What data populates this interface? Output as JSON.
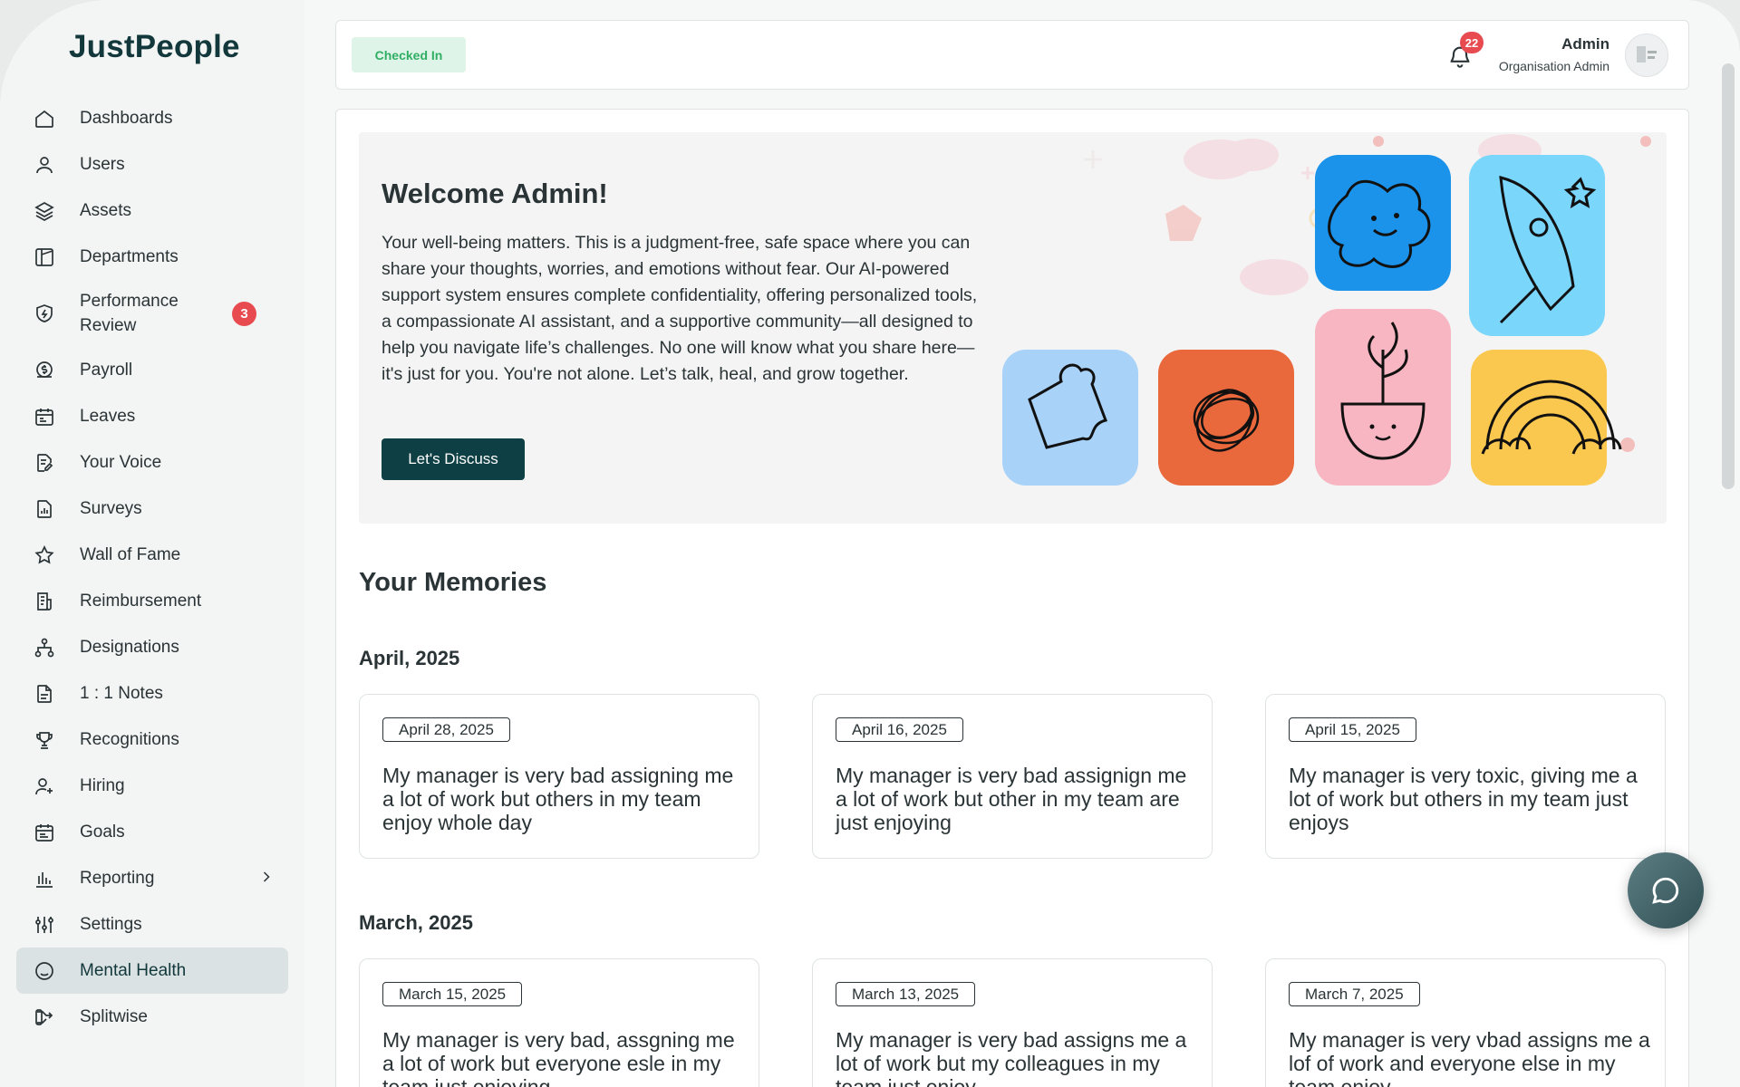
{
  "app": {
    "logo": "JustPeople"
  },
  "sidebar": {
    "items": [
      {
        "label": "Dashboards",
        "icon": "home-icon"
      },
      {
        "label": "Users",
        "icon": "user-icon"
      },
      {
        "label": "Assets",
        "icon": "layers-icon"
      },
      {
        "label": "Departments",
        "icon": "building-icon"
      },
      {
        "label": "Performance Review",
        "icon": "shield-icon",
        "badge": "3"
      },
      {
        "label": "Payroll",
        "icon": "dollar-coin-icon"
      },
      {
        "label": "Leaves",
        "icon": "calendar-icon"
      },
      {
        "label": "Your Voice",
        "icon": "document-edit-icon"
      },
      {
        "label": "Surveys",
        "icon": "document-chart-icon"
      },
      {
        "label": "Wall of Fame",
        "icon": "star-icon"
      },
      {
        "label": "Reimbursement",
        "icon": "receipt-icon"
      },
      {
        "label": "Designations",
        "icon": "hierarchy-icon"
      },
      {
        "label": "1 : 1 Notes",
        "icon": "note-icon"
      },
      {
        "label": "Recognitions",
        "icon": "trophy-icon"
      },
      {
        "label": "Hiring",
        "icon": "user-plus-icon"
      },
      {
        "label": "Goals",
        "icon": "calendar-check-icon"
      },
      {
        "label": "Reporting",
        "icon": "bar-chart-icon"
      },
      {
        "label": "Settings",
        "icon": "sliders-icon"
      },
      {
        "label": "Mental Health",
        "icon": "smile-icon",
        "active": true
      },
      {
        "label": "Splitwise",
        "icon": "split-icon"
      }
    ]
  },
  "header": {
    "status": "Checked In",
    "notifications_count": "22",
    "user_name": "Admin",
    "user_role": "Organisation Admin"
  },
  "hero": {
    "title": "Welcome Admin!",
    "text": "Your well-being matters. This is a judgment-free, safe space where you can share your thoughts, worries, and emotions without fear. Our AI-powered support system ensures complete confidentiality, offering personalized tools, a compassionate AI assistant, and a supportive community—all designed to help you navigate life’s challenges. No one will know what you share here—it's just for you. You're not alone. Let’s talk, heal, and grow together.",
    "button": "Let's Discuss"
  },
  "memories": {
    "title": "Your Memories",
    "groups": [
      {
        "month": "April, 2025",
        "cards": [
          {
            "date": "April 28, 2025",
            "text": "My manager is very bad assigning me a lot of work but others in my team enjoy whole day"
          },
          {
            "date": "April 16, 2025",
            "text": "My manager is very bad assignign me a lot of work but other in my team are just enjoying"
          },
          {
            "date": "April 15, 2025",
            "text": "My manager is very toxic, giving me a lot of work but others in my team just enjoys"
          }
        ]
      },
      {
        "month": "March, 2025",
        "cards": [
          {
            "date": "March 15, 2025",
            "text": "My manager is very bad, assgning me a lot of work but everyone esle in my team just enjoying"
          },
          {
            "date": "March 13, 2025",
            "text": "My manager is very bad assigns me a lot of work but my colleagues in my team just enjoy"
          },
          {
            "date": "March 7, 2025",
            "text": "My manager is very vbad assigns me a lof of work and everyone else in my team enjoy"
          }
        ]
      }
    ]
  },
  "colors": {
    "primary": "#0e3f45",
    "badge": "#e84b4f",
    "checked_bg": "#dff4e8",
    "checked_text": "#2fae64",
    "active_nav": "#dbe2e3"
  }
}
